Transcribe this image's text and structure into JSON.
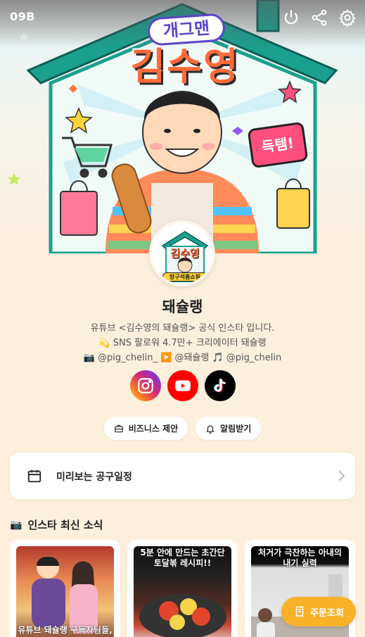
{
  "header": {
    "brand": "09B",
    "icons": [
      "power-icon",
      "share-icon",
      "gear-icon"
    ]
  },
  "hero": {
    "pill_text": "개그맨",
    "title_text": "김수영",
    "badge_text": "득템!"
  },
  "profile": {
    "logo_title": "김수영",
    "logo_top": "개그맨",
    "logo_sub": "방구석홈쇼핑",
    "name": "돼슐랭",
    "bio": [
      "유튜브 <김수영의 돼슐랭> 공식 인스타 입니다.",
      "💫 SNS 팔로워 4.7만+ 크리에이터 돼슐랭",
      "📷 @pig_chelin_ ▶️ @돼슐랭 🎵 @pig_chelin"
    ]
  },
  "socials": [
    {
      "name": "instagram",
      "icon": "instagram-icon"
    },
    {
      "name": "youtube",
      "icon": "youtube-icon"
    },
    {
      "name": "tiktok",
      "icon": "tiktok-icon"
    }
  ],
  "actions": {
    "business_label": "비즈니스 제안",
    "notify_label": "알림받기"
  },
  "schedule": {
    "label": "미리보는 공구일정"
  },
  "feed": {
    "title": "인스타 최신 소식",
    "cards": [
      {
        "caption": "유튜브 돼슐랭 구독자님들,"
      },
      {
        "caption": "5분 안에 만드는 초간단 토달볶 레시피!!"
      },
      {
        "caption": "처거가 극찬하는 아내의 내기 실력"
      }
    ]
  },
  "order_button": {
    "label": "주문조회"
  },
  "colors": {
    "background": "#fcefdc",
    "accent_orange": "#f9b128",
    "house_teal": "#1aa08e",
    "title_orange": "#ff6b3a",
    "pill_purple": "#5c44c7"
  }
}
